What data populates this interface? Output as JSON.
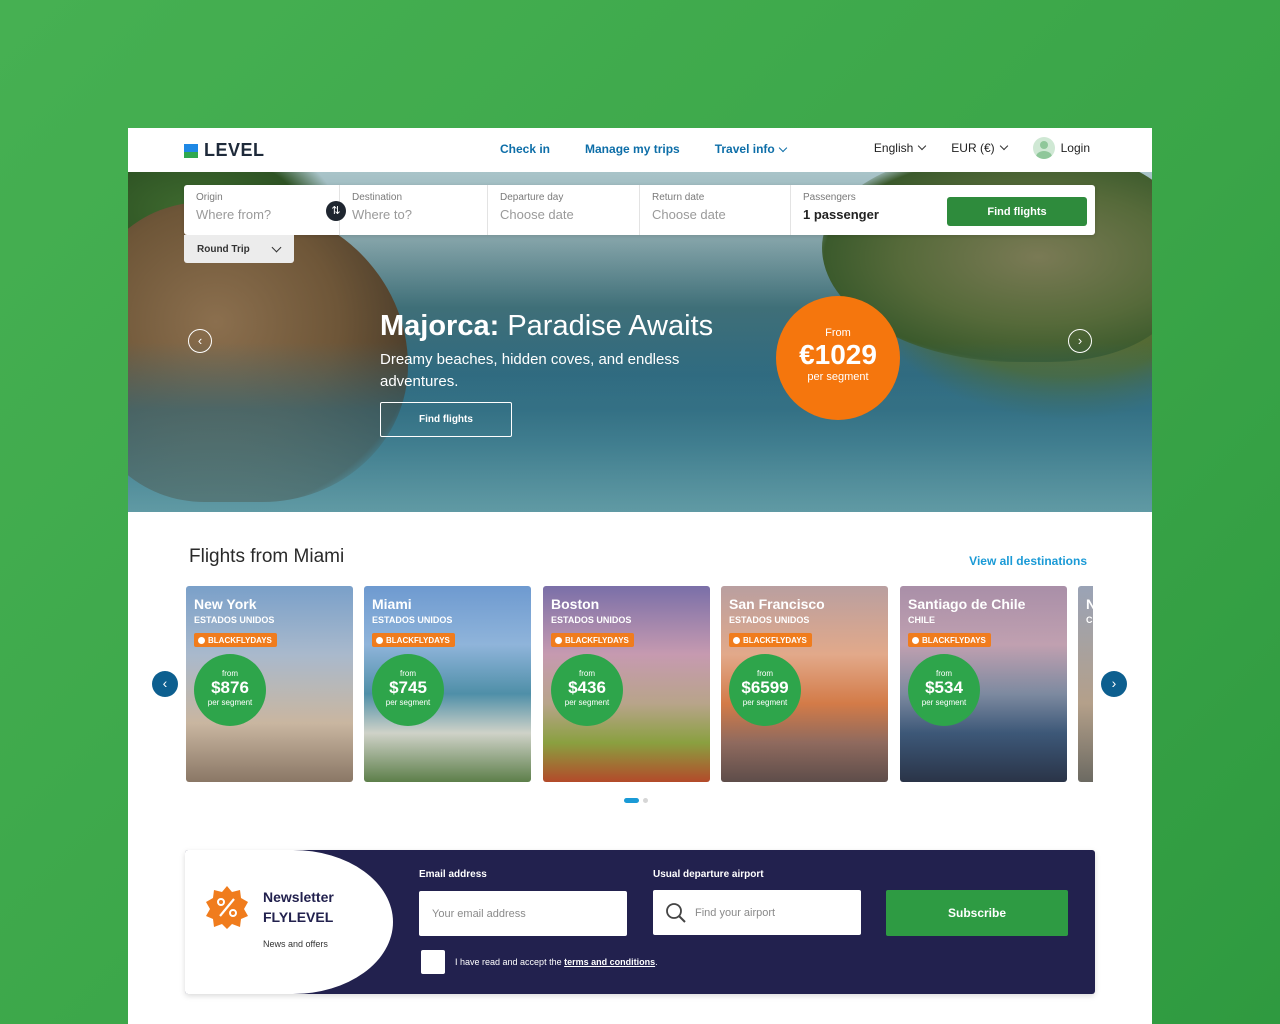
{
  "header": {
    "logo_text": "LEVEL",
    "nav": [
      "Check in",
      "Manage my trips",
      "Travel info"
    ],
    "language": "English",
    "currency": "EUR (€)",
    "login": "Login"
  },
  "search": {
    "origin_label": "Origin",
    "origin_placeholder": "Where from?",
    "destination_label": "Destination",
    "destination_placeholder": "Where to?",
    "departure_label": "Departure day",
    "departure_placeholder": "Choose date",
    "return_label": "Return date",
    "return_placeholder": "Choose date",
    "passengers_label": "Passengers",
    "passengers_value": "1 passenger",
    "find_button": "Find flights",
    "trip_type": "Round Trip"
  },
  "hero": {
    "title_bold": "Majorca:",
    "title_light": "Paradise Awaits",
    "subtitle": "Dreamy beaches, hidden coves, and endless adventures.",
    "cta": "Find flights",
    "price_from": "From",
    "price": "€1029",
    "price_unit": "per segment"
  },
  "flights": {
    "title": "Flights from Miami",
    "view_all": "View all destinations",
    "cards": [
      {
        "city": "New York",
        "country": "ESTADOS UNIDOS",
        "promo": "BLACKFLYDAYS",
        "from": "from",
        "price": "$876",
        "per": "per segment",
        "bg": "linear-gradient(180deg,#7aa0c9 0%,#a9b9cc 35%,#c9b6a0 70%,#8a7766 100%)"
      },
      {
        "city": "Miami",
        "country": "ESTADOS UNIDOS",
        "promo": "BLACKFLYDAYS",
        "from": "from",
        "price": "$745",
        "per": "per segment",
        "bg": "linear-gradient(180deg,#6e9ad0 0%,#8fb4da 30%,#4f8fa8 55%,#cfd2c8 75%,#5d7f4a 100%)"
      },
      {
        "city": "Boston",
        "country": "ESTADOS UNIDOS",
        "promo": "BLACKFLYDAYS",
        "from": "from",
        "price": "$436",
        "per": "per segment",
        "bg": "linear-gradient(180deg,#7a6fa8 0%,#c69ab0 35%,#b8a48a 60%,#8aa040 80%,#b34a2a 100%)"
      },
      {
        "city": "San Francisco",
        "country": "ESTADOS UNIDOS",
        "promo": "BLACKFLYDAYS",
        "from": "from",
        "price": "$6599",
        "per": "per segment",
        "bg": "linear-gradient(180deg,#b99fa0 0%,#e2a98a 35%,#d37b48 60%,#8f6a5e 80%,#5e4d4a 100%)"
      },
      {
        "city": "Santiago de Chile",
        "country": "CHILE",
        "promo": "BLACKFLYDAYS",
        "from": "from",
        "price": "$534",
        "per": "per segment",
        "bg": "linear-gradient(180deg,#a98fa8 0%,#c0a0b0 30%,#7d8aa0 55%,#3d5878 75%,#2a3448 100%)"
      },
      {
        "city": "N",
        "country": "C",
        "promo": "",
        "from": "",
        "price": "",
        "per": "",
        "bg": "linear-gradient(180deg,#9aa3b6 0%,#b4a08a 60%,#6c6a62 100%)"
      }
    ]
  },
  "newsletter": {
    "title_line1": "Newsletter",
    "title_line2": "FLYLEVEL",
    "subtitle": "News and offers",
    "email_label": "Email address",
    "email_placeholder": "Your email address",
    "airport_label": "Usual departure airport",
    "airport_placeholder": "Find your airport",
    "subscribe": "Subscribe",
    "terms_prefix": "I have read and accept the",
    "terms_link": "terms and conditions",
    "terms_suffix": "."
  },
  "colors": {
    "brand_green": "#2e8b3c",
    "accent_orange": "#f5760d",
    "navy": "#22214e",
    "link_blue": "#1a9ad6"
  }
}
